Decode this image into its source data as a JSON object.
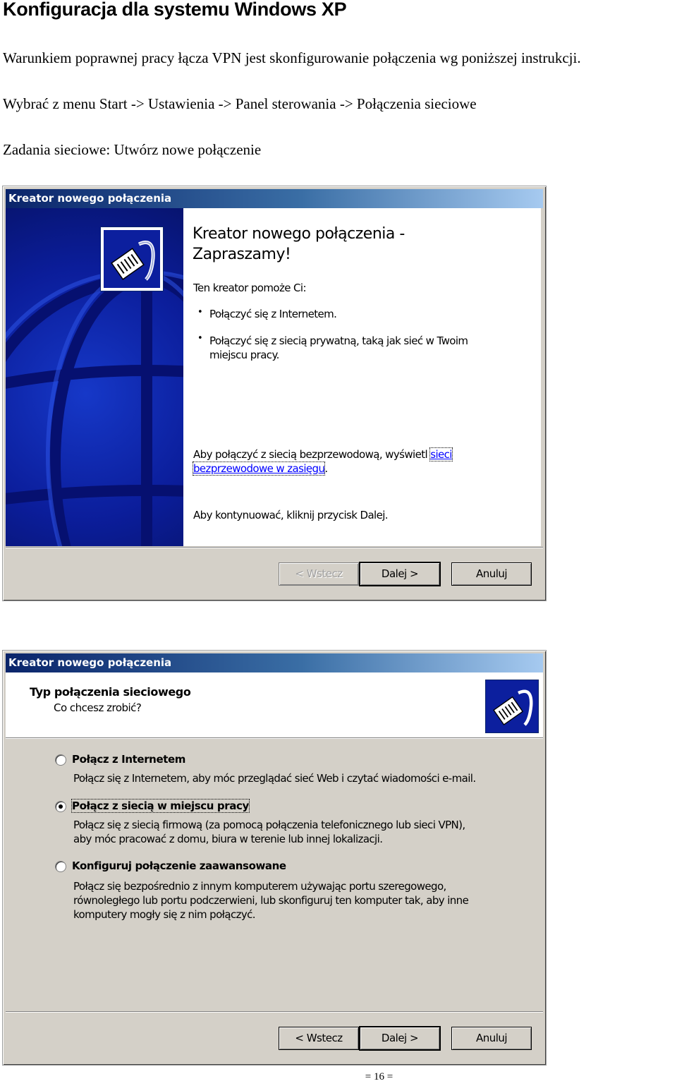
{
  "document": {
    "title": "Konfiguracja dla systemu Windows XP",
    "paragraph1": "Warunkiem poprawnej pracy łącza VPN jest skonfigurowanie połączenia wg poniższej instrukcji.",
    "paragraph2": "Wybrać z menu Start -> Ustawienia -> Panel sterowania -> Połączenia sieciowe",
    "paragraph3": "Zadania sieciowe: Utwórz nowe połączenie",
    "page_number": "= 16 ="
  },
  "dialog1": {
    "title": "Kreator nowego połączenia",
    "heading": "Kreator nowego połączenia - Zapraszamy!",
    "intro": "Ten kreator pomoże Ci:",
    "bullet1": "Połączyć się z Internetem.",
    "bullet2_line1": "Połączyć się z siecią prywatną, taką jak sieć w Twoim",
    "bullet2_line2": "miejscu pracy.",
    "wireless_text": "Aby połączyć z siecią bezprzewodową, wyświetl",
    "wireless_link1": "sieci",
    "wireless_link2": "bezprzewodowe w zasięgu",
    "wireless_end": ".",
    "continue_text": "Aby kontynuować, kliknij przycisk Dalej.",
    "buttons": {
      "back": "< Wstecz",
      "next": "Dalej >",
      "cancel": "Anuluj"
    },
    "icon": "network-cable-icon",
    "back_disabled": true
  },
  "dialog2": {
    "title": "Kreator nowego połączenia",
    "header_title": "Typ połączenia sieciowego",
    "header_subtitle": "Co chcesz zrobić?",
    "icon": "network-cable-icon",
    "options": [
      {
        "label": "Połącz z Internetem",
        "description": "Połącz się z Internetem, aby móc przeglądać sieć Web i czytać wiadomości e-mail.",
        "selected": false
      },
      {
        "label": "Połącz z siecią w miejscu pracy",
        "description": "Połącz się z siecią firmową (za pomocą połączenia telefonicznego lub sieci VPN),\naby móc pracować z domu, biura w terenie lub innej lokalizacji.",
        "selected": true
      },
      {
        "label": "Konfiguruj połączenie zaawansowane",
        "description": "Połącz się bezpośrednio z innym komputerem używając portu szeregowego,\nrównoległego lub portu podczerwieni, lub skonfiguruj ten komputer tak, aby inne\nkomputery mogły się z nim połączyć.",
        "selected": false
      }
    ],
    "buttons": {
      "back": "< Wstecz",
      "next": "Dalej >",
      "cancel": "Anuluj"
    }
  },
  "colors": {
    "titlebar_start": "#0a246a",
    "titlebar_end": "#a6caf0",
    "dialog_face": "#d4d0c8",
    "sidebar_blue": "#0b1d9a",
    "link": "#0000ff"
  }
}
